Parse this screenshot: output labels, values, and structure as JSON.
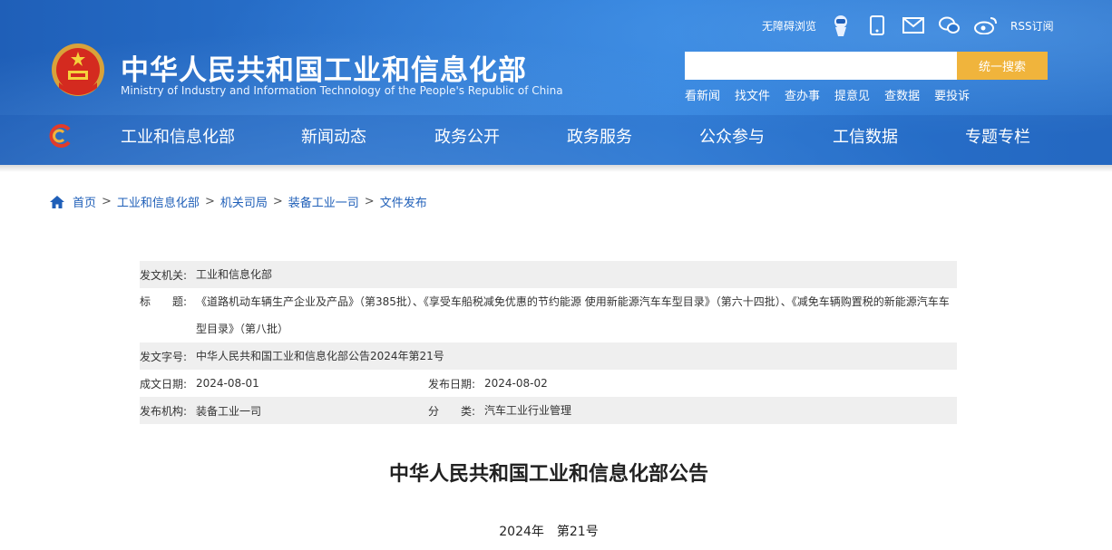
{
  "site": {
    "title_cn": "中华人民共和国工业和信息化部",
    "title_en": "Ministry of Industry and Information Technology of the People's Republic of China"
  },
  "toplinks": {
    "accessibility": "无障碍浏览",
    "rss": "RSS订阅"
  },
  "search": {
    "placeholder": "",
    "button": "统一搜索"
  },
  "quicklinks": [
    "看新闻",
    "找文件",
    "查办事",
    "提意见",
    "查数据",
    "要投诉"
  ],
  "nav": [
    "工业和信息化部",
    "新闻动态",
    "政务公开",
    "政务服务",
    "公众参与",
    "工信数据",
    "专题专栏"
  ],
  "breadcrumb": [
    "首页",
    "工业和信息化部",
    "机关司局",
    "装备工业一司",
    "文件发布"
  ],
  "meta": {
    "issuer_label": "发文机关:",
    "issuer": "工业和信息化部",
    "title_label": "标　　题:",
    "title": "《道路机动车辆生产企业及产品》（第385批）、《享受车船税减免优惠的节约能源 使用新能源汽车车型目录》（第六十四批）、《减免车辆购置税的新能源汽车车型目录》（第八批）",
    "docno_label": "发文字号:",
    "docno": "中华人民共和国工业和信息化部公告2024年第21号",
    "created_label": "成文日期:",
    "created": "2024-08-01",
    "published_label": "发布日期:",
    "published": "2024-08-02",
    "org_label": "发布机构:",
    "org": "装备工业一司",
    "category_label": "分　　类:",
    "category": "汽车工业行业管理"
  },
  "document": {
    "title": "中华人民共和国工业和信息化部公告",
    "number": "2024年　第21号"
  },
  "colors": {
    "header_blue": "#2a74cf",
    "search_button": "#f0b43c",
    "link_blue": "#1f5fb8"
  }
}
